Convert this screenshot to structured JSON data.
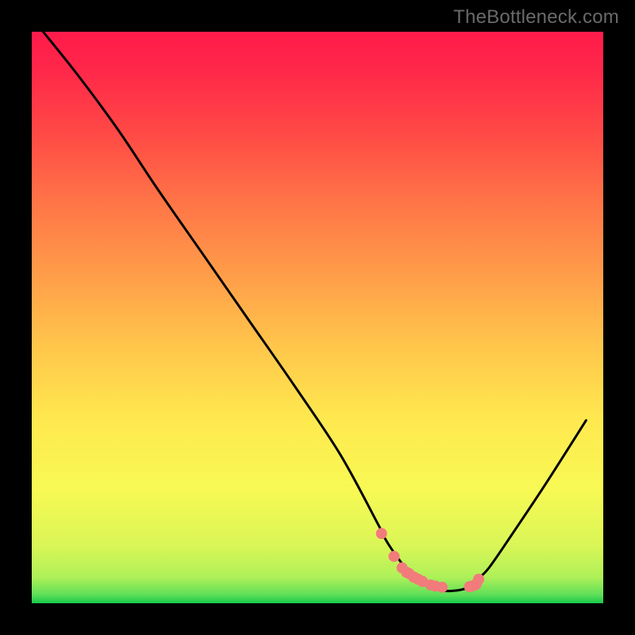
{
  "watermark": {
    "text": "TheBottleneck.com"
  },
  "chart_data": {
    "type": "line",
    "title": "",
    "xlabel": "",
    "ylabel": "",
    "xlim": [
      0,
      100
    ],
    "ylim": [
      0,
      100
    ],
    "grid": false,
    "series": [
      {
        "name": "curve",
        "color": "#000000",
        "x": [
          2,
          8,
          15,
          22,
          30,
          38,
          46,
          54,
          60.5,
          62,
          64,
          66,
          68,
          70,
          72,
          74,
          76,
          77,
          78,
          80,
          84,
          90,
          97
        ],
        "y": [
          100,
          92.5,
          83,
          72.5,
          61,
          49.5,
          38,
          26,
          14,
          11,
          8,
          5.5,
          3.8,
          2.8,
          2.2,
          2.2,
          2.6,
          3.2,
          4.2,
          6.2,
          12,
          21,
          32
        ]
      },
      {
        "name": "dots",
        "color": "#f27b7b",
        "x": [
          61.2,
          63.4,
          64.8,
          65.6,
          66.0,
          66.8,
          67.0,
          67.6,
          68.4,
          69.8,
          70.6,
          71.8,
          76.6,
          77.0,
          77.6,
          77.8,
          78.2
        ],
        "y": [
          12.2,
          8.2,
          6.2,
          5.4,
          5.2,
          4.6,
          4.5,
          4.2,
          3.8,
          3.2,
          3.0,
          2.8,
          2.9,
          3.0,
          3.2,
          3.4,
          4.2
        ]
      }
    ],
    "dot_radius_px": 7,
    "gradient": {
      "stops": [
        {
          "offset": 0.0,
          "color": "#ff1b4b"
        },
        {
          "offset": 0.07,
          "color": "#ff2849"
        },
        {
          "offset": 0.18,
          "color": "#ff4a46"
        },
        {
          "offset": 0.3,
          "color": "#ff7547"
        },
        {
          "offset": 0.42,
          "color": "#ff9b49"
        },
        {
          "offset": 0.55,
          "color": "#ffc64b"
        },
        {
          "offset": 0.68,
          "color": "#ffe94f"
        },
        {
          "offset": 0.8,
          "color": "#f8f954"
        },
        {
          "offset": 0.9,
          "color": "#d9f656"
        },
        {
          "offset": 0.955,
          "color": "#aef059"
        },
        {
          "offset": 0.985,
          "color": "#5fdf58"
        },
        {
          "offset": 1.0,
          "color": "#17c94c"
        }
      ]
    }
  }
}
